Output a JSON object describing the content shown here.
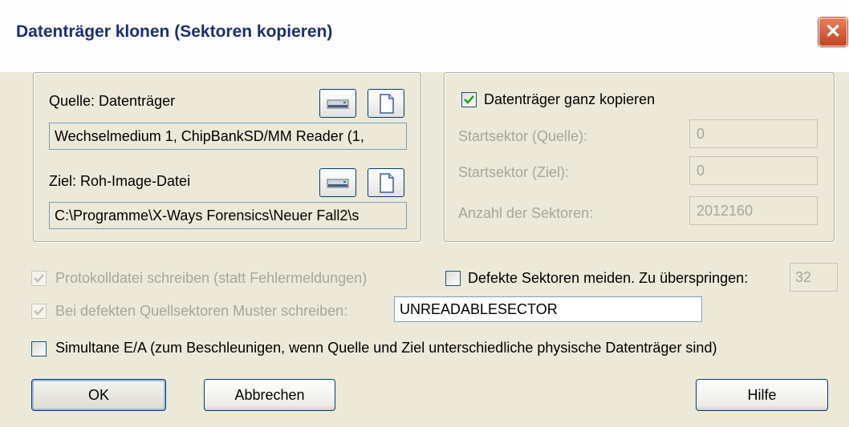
{
  "window": {
    "title": "Datenträger klonen (Sektoren kopieren)"
  },
  "source": {
    "label": "Quelle: Datenträger",
    "value": "Wechselmedium 1, ChipBankSD/MM Reader (1,"
  },
  "target": {
    "label": "Ziel: Roh-Image-Datei",
    "value": "C:\\Programme\\X-Ways Forensics\\Neuer Fall2\\s"
  },
  "copy_options": {
    "whole_disk_label": "Datenträger ganz kopieren",
    "whole_disk_checked": true,
    "start_source_label": "Startsektor (Quelle):",
    "start_source_value": "0",
    "start_target_label": "Startsektor (Ziel):",
    "start_target_value": "0",
    "count_label": "Anzahl der Sektoren:",
    "count_value": "2012160"
  },
  "options": {
    "log_label": "Protokolldatei schreiben (statt Fehlermeldungen)",
    "log_checked": true,
    "skip_label": "Defekte Sektoren meiden. Zu überspringen:",
    "skip_checked": false,
    "skip_value": "32",
    "pattern_label": "Bei defekten Quellsektoren Muster schreiben:",
    "pattern_checked": true,
    "pattern_value": "UNREADABLESECTOR",
    "simul_label": "Simultane E/A (zum Beschleunigen, wenn Quelle und Ziel unterschiedliche physische Datenträger sind)",
    "simul_checked": false
  },
  "buttons": {
    "ok": "OK",
    "cancel": "Abbrechen",
    "help": "Hilfe"
  },
  "icons": [
    "disk-icon",
    "file-icon",
    "close-icon",
    "checkmark-icon"
  ]
}
